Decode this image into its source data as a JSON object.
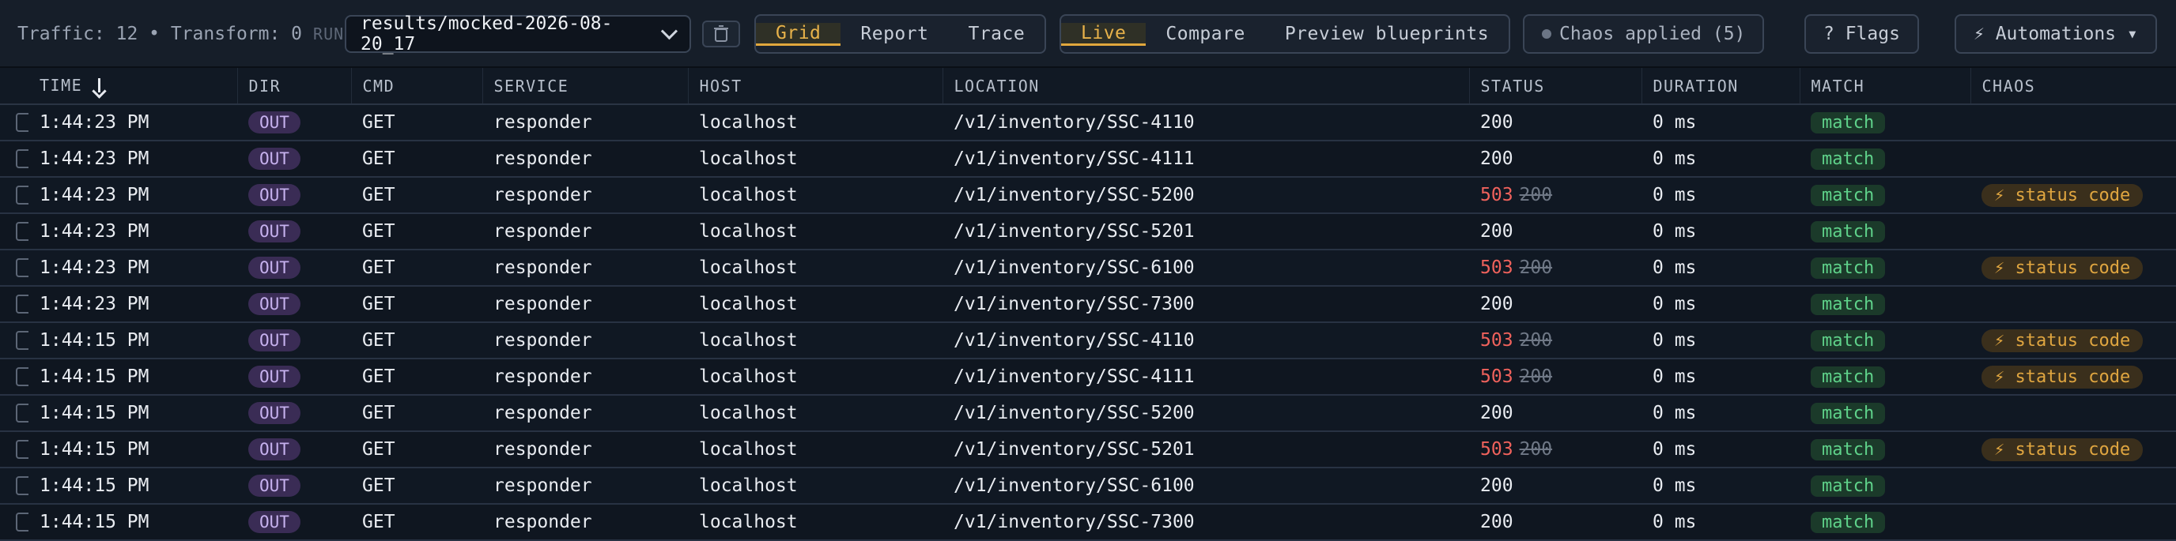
{
  "toolbar": {
    "traffic_text": "Traffic: 12 • Transform: 0",
    "run_label": "RUN",
    "run_select_value": "results/mocked-2026-08-20_17",
    "view_tabs": [
      "Grid",
      "Report",
      "Trace"
    ],
    "active_view": "Grid",
    "mode_tabs": [
      "Live",
      "Compare",
      "Preview blueprints"
    ],
    "active_mode": "Live",
    "chaos_button": "Chaos applied (5)",
    "flags_button": "? Flags",
    "automations_button": "⚡ Automations ▾"
  },
  "table": {
    "columns": [
      "TIME",
      "DIR",
      "CMD",
      "SERVICE",
      "HOST",
      "LOCATION",
      "STATUS",
      "DURATION",
      "MATCH",
      "CHAOS"
    ],
    "sort_column": "TIME",
    "rows": [
      {
        "time": "1:44:23 PM",
        "dir": "OUT",
        "cmd": "GET",
        "service": "responder",
        "host": "localhost",
        "location": "/v1/inventory/SSC-4110",
        "status": "200",
        "status_old": "",
        "duration": "0 ms",
        "match": "match",
        "chaos": ""
      },
      {
        "time": "1:44:23 PM",
        "dir": "OUT",
        "cmd": "GET",
        "service": "responder",
        "host": "localhost",
        "location": "/v1/inventory/SSC-4111",
        "status": "200",
        "status_old": "",
        "duration": "0 ms",
        "match": "match",
        "chaos": ""
      },
      {
        "time": "1:44:23 PM",
        "dir": "OUT",
        "cmd": "GET",
        "service": "responder",
        "host": "localhost",
        "location": "/v1/inventory/SSC-5200",
        "status": "503",
        "status_old": "200",
        "duration": "0 ms",
        "match": "match",
        "chaos": "⚡ status code"
      },
      {
        "time": "1:44:23 PM",
        "dir": "OUT",
        "cmd": "GET",
        "service": "responder",
        "host": "localhost",
        "location": "/v1/inventory/SSC-5201",
        "status": "200",
        "status_old": "",
        "duration": "0 ms",
        "match": "match",
        "chaos": ""
      },
      {
        "time": "1:44:23 PM",
        "dir": "OUT",
        "cmd": "GET",
        "service": "responder",
        "host": "localhost",
        "location": "/v1/inventory/SSC-6100",
        "status": "503",
        "status_old": "200",
        "duration": "0 ms",
        "match": "match",
        "chaos": "⚡ status code"
      },
      {
        "time": "1:44:23 PM",
        "dir": "OUT",
        "cmd": "GET",
        "service": "responder",
        "host": "localhost",
        "location": "/v1/inventory/SSC-7300",
        "status": "200",
        "status_old": "",
        "duration": "0 ms",
        "match": "match",
        "chaos": ""
      },
      {
        "time": "1:44:15 PM",
        "dir": "OUT",
        "cmd": "GET",
        "service": "responder",
        "host": "localhost",
        "location": "/v1/inventory/SSC-4110",
        "status": "503",
        "status_old": "200",
        "duration": "0 ms",
        "match": "match",
        "chaos": "⚡ status code"
      },
      {
        "time": "1:44:15 PM",
        "dir": "OUT",
        "cmd": "GET",
        "service": "responder",
        "host": "localhost",
        "location": "/v1/inventory/SSC-4111",
        "status": "503",
        "status_old": "200",
        "duration": "0 ms",
        "match": "match",
        "chaos": "⚡ status code"
      },
      {
        "time": "1:44:15 PM",
        "dir": "OUT",
        "cmd": "GET",
        "service": "responder",
        "host": "localhost",
        "location": "/v1/inventory/SSC-5200",
        "status": "200",
        "status_old": "",
        "duration": "0 ms",
        "match": "match",
        "chaos": ""
      },
      {
        "time": "1:44:15 PM",
        "dir": "OUT",
        "cmd": "GET",
        "service": "responder",
        "host": "localhost",
        "location": "/v1/inventory/SSC-5201",
        "status": "503",
        "status_old": "200",
        "duration": "0 ms",
        "match": "match",
        "chaos": "⚡ status code"
      },
      {
        "time": "1:44:15 PM",
        "dir": "OUT",
        "cmd": "GET",
        "service": "responder",
        "host": "localhost",
        "location": "/v1/inventory/SSC-6100",
        "status": "200",
        "status_old": "",
        "duration": "0 ms",
        "match": "match",
        "chaos": ""
      },
      {
        "time": "1:44:15 PM",
        "dir": "OUT",
        "cmd": "GET",
        "service": "responder",
        "host": "localhost",
        "location": "/v1/inventory/SSC-7300",
        "status": "200",
        "status_old": "",
        "duration": "0 ms",
        "match": "match",
        "chaos": ""
      }
    ]
  }
}
